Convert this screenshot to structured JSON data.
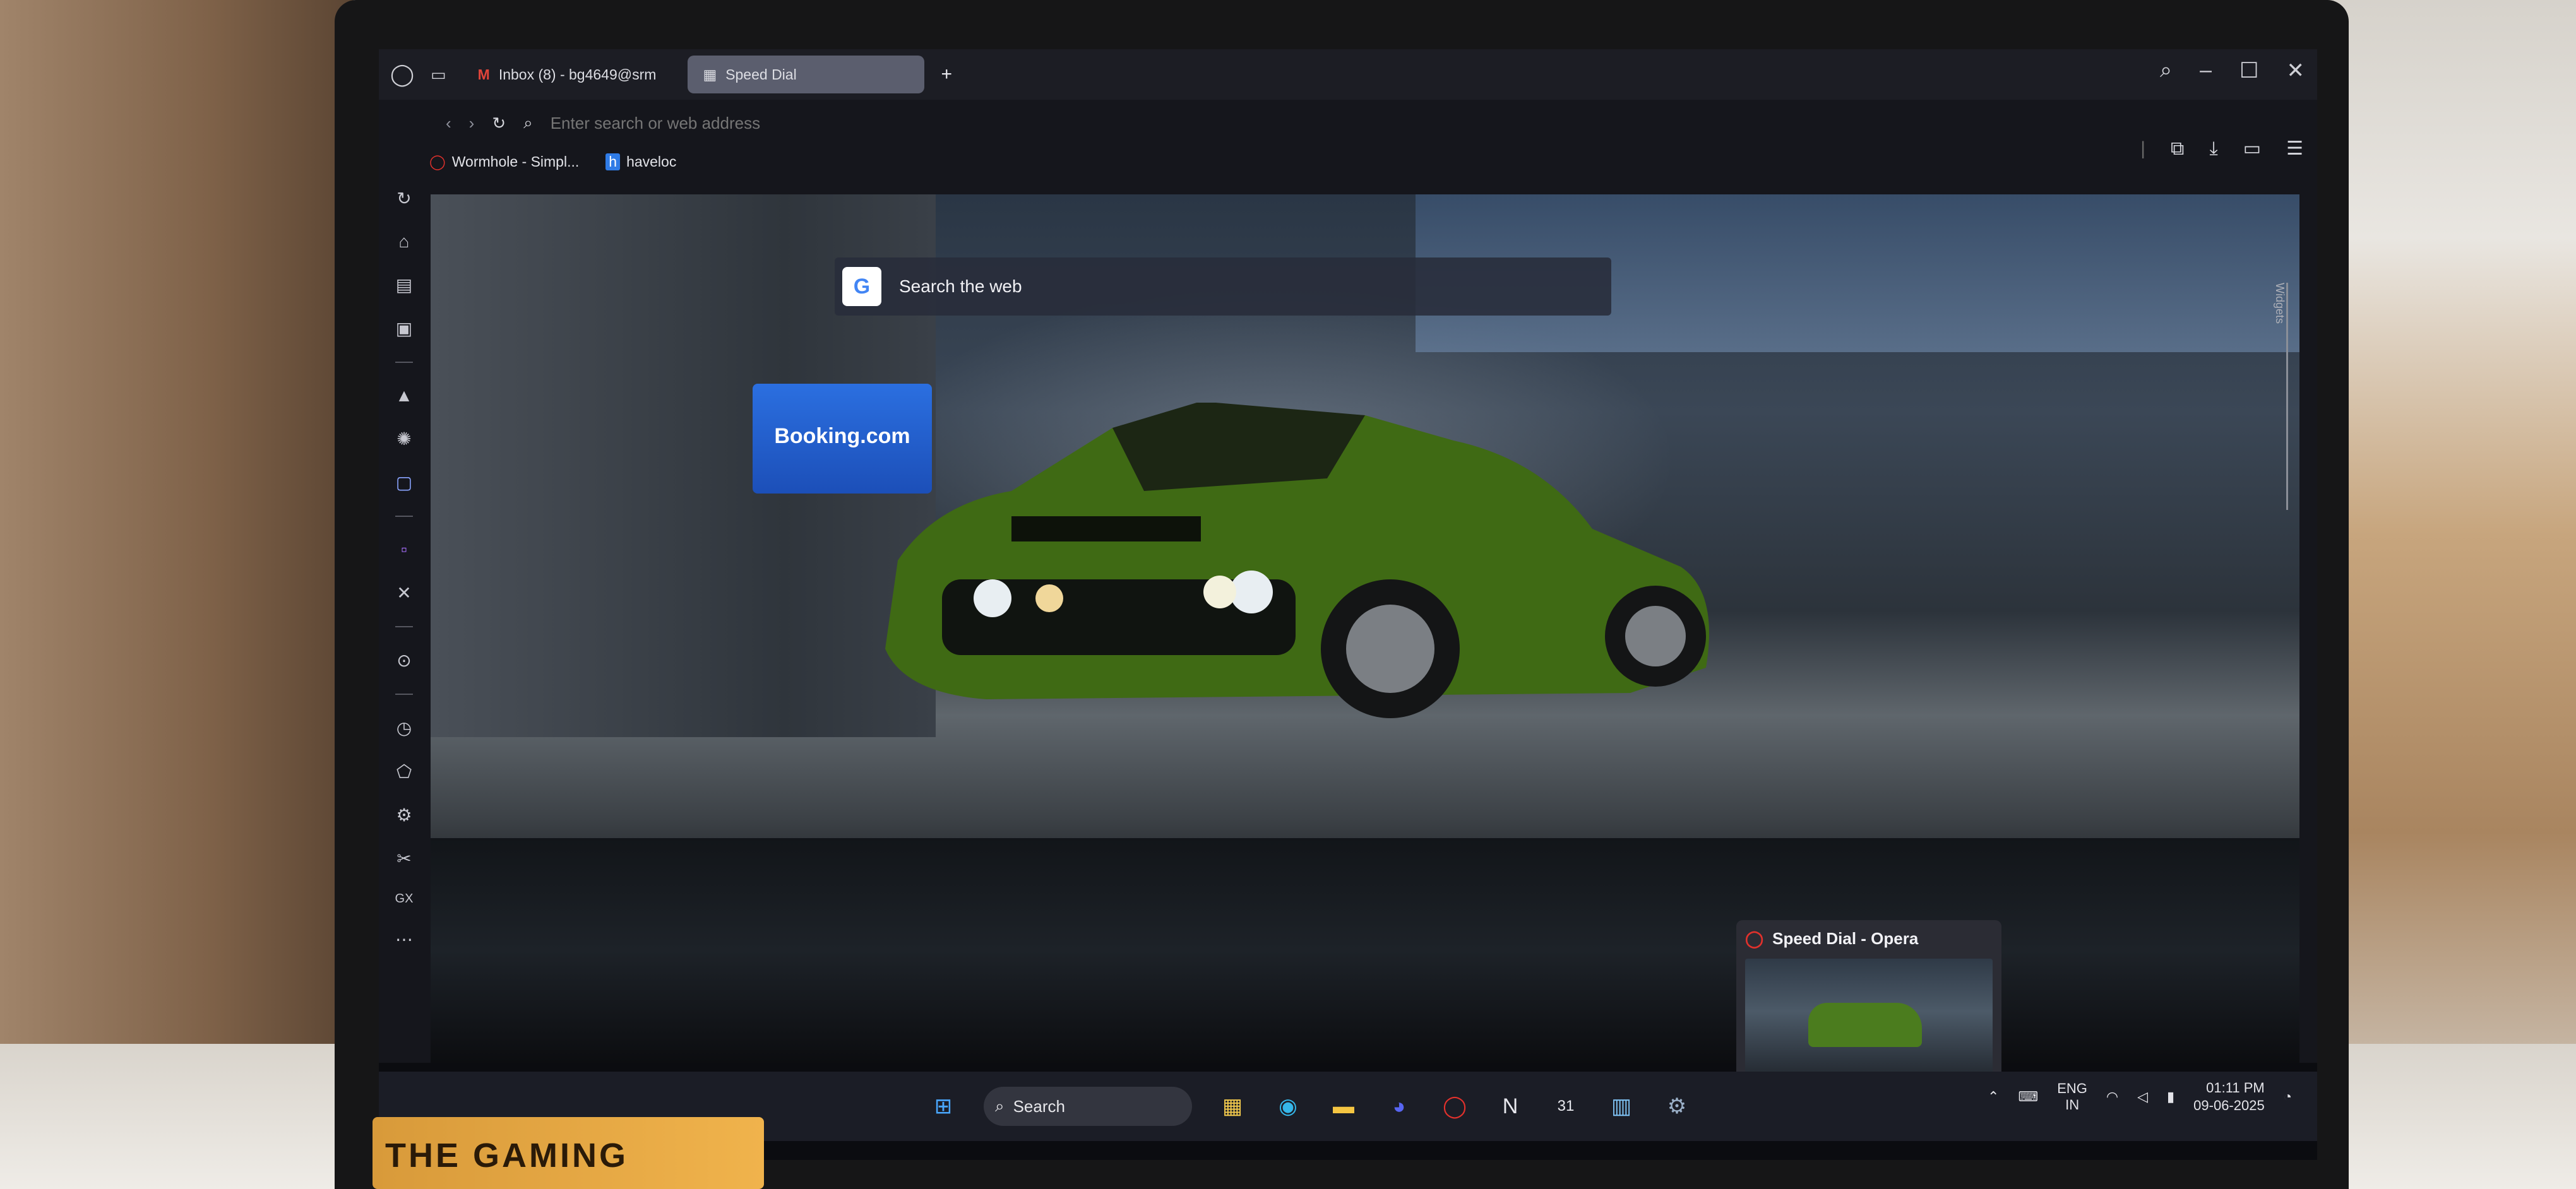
{
  "browser": {
    "tabs": [
      {
        "label": "Inbox (8) - bg4649@srm",
        "icon": "gmail-icon"
      },
      {
        "label": "Speed Dial",
        "icon": "speed-dial-icon",
        "active": true
      }
    ],
    "new_tab_glyph": "+",
    "address_placeholder": "Enter search or web address",
    "bookmarks": [
      {
        "label": "Wormhole - Simpl...",
        "icon": "opera-icon"
      },
      {
        "label": "haveloc",
        "icon": "haveloc-icon"
      }
    ],
    "accent_color": "#5b5e6e"
  },
  "speed_dial": {
    "search_label": "Search the web",
    "booking_tile": "Booking.com",
    "widgets_label": "Widgets"
  },
  "preview": {
    "title": "Speed Dial - Opera"
  },
  "taskbar": {
    "search_label": "Search",
    "language_top": "ENG",
    "language_bottom": "IN",
    "time": "01:11 PM",
    "date": "09-06-2025"
  },
  "sticker": {
    "text": "THE GAMING"
  }
}
